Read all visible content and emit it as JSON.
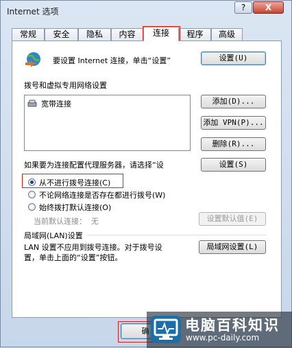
{
  "window": {
    "title": "Internet 选项",
    "help": "?",
    "close": "X"
  },
  "tabs": [
    {
      "label": "常规"
    },
    {
      "label": "安全"
    },
    {
      "label": "隐私"
    },
    {
      "label": "内容"
    },
    {
      "label": "连接",
      "active": true
    },
    {
      "label": "程序"
    },
    {
      "label": "高级"
    }
  ],
  "setup": {
    "text": "要设置 Internet 连接，单击“设置”",
    "button": "设置(U)"
  },
  "dialup": {
    "heading": "拨号和虚拟专用网络设置",
    "items": [
      "宽带连接"
    ],
    "add": "添加(D)...",
    "add_vpn": "添加 VPN(P)...",
    "remove": "删除(R)...",
    "proxy_text": "如果要为连接配置代理服务器，请选择“设",
    "settings": "设置(S)",
    "options": [
      {
        "label": "从不进行拨号连接(C)",
        "selected": true
      },
      {
        "label": "不论网络连接是否存在都进行拨号(W)",
        "selected": false
      },
      {
        "label": "始终拨打默认连接(O)",
        "selected": false
      }
    ],
    "default_label": "当前默认连接：",
    "default_value": "无",
    "set_default": "设置默认值(E)"
  },
  "lan": {
    "heading": "局域网(LAN)设置",
    "text_line1": "LAN 设置不应用到拨号连接。对于拨号设",
    "text_line2": "置，单击上面的“设置”按钮。",
    "button": "局域网设置(L)"
  },
  "footer": {
    "ok": "确"
  },
  "watermark": {
    "title": "电脑百科知识",
    "url": "www.pc-daily.com"
  },
  "colors": {
    "highlight": "#d9241b",
    "selected_radio": "#1d3f7d"
  }
}
